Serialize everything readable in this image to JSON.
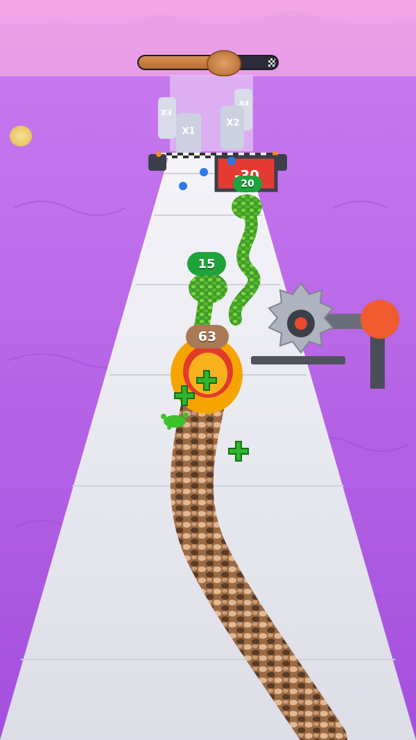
{
  "hud": {
    "progress_fraction": 0.6,
    "player_head_icon": "snake-head-icon",
    "finish_icon": "checkered-flag-icon",
    "coin_icon": "coin-icon"
  },
  "multipliers": {
    "x1": "X1",
    "x2": "X2",
    "x3": "X3",
    "x4": "X4"
  },
  "gate": {
    "value": "-30"
  },
  "enemies": [
    {
      "count": "20"
    },
    {
      "count": "15"
    }
  ],
  "player": {
    "count": "63"
  },
  "colors": {
    "sky": "#f0a4e3",
    "lava": "#b565e6",
    "track": "#e7e8ef",
    "player_badge": "#a97a55",
    "enemy_badge": "#1fa33a",
    "gate": "#e53a33",
    "saw_arm": "#f05b2f"
  }
}
